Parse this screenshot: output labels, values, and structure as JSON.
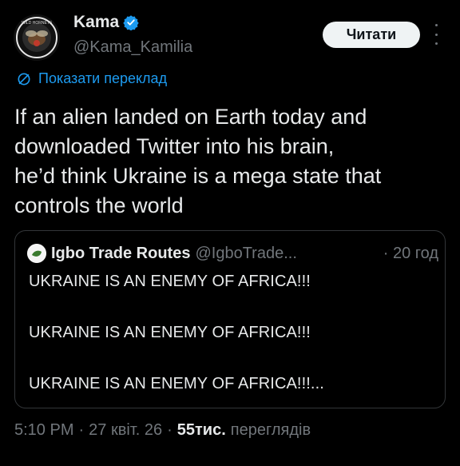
{
  "author": {
    "name": "Kama",
    "handle": "@Kama_Kamilia",
    "avatar_text": "WILD HORNETS",
    "verified_color": "#1d9bf0"
  },
  "header": {
    "follow_label": "Читати",
    "more_icon": "more-vertical-icon"
  },
  "translate": {
    "label": "Показати переклад",
    "icon": "translate-icon"
  },
  "tweet": {
    "text": "If an alien landed on Earth today and\ndownloaded Twitter into his brain,\nhe’d think Ukraine is a mega state that\ncontrols the world"
  },
  "quote": {
    "name": "Igbo Trade Routes",
    "handle": "@IgboTrade...",
    "time": "· 20 год",
    "lines": [
      "UKRAINE IS AN ENEMY OF AFRICA!!!",
      "UKRAINE IS AN ENEMY OF AFRICA!!!",
      "UKRAINE IS AN ENEMY OF AFRICA!!!..."
    ]
  },
  "meta": {
    "time": "5:10 PM",
    "sep1": "·",
    "date": "27 квіт. 26",
    "sep2": "·",
    "views_num": "55тис.",
    "views_label": "переглядів"
  },
  "colors": {
    "background": "#000000",
    "text": "#e7e9ea",
    "muted": "#71767b",
    "link": "#1d9bf0",
    "border": "#333639"
  }
}
